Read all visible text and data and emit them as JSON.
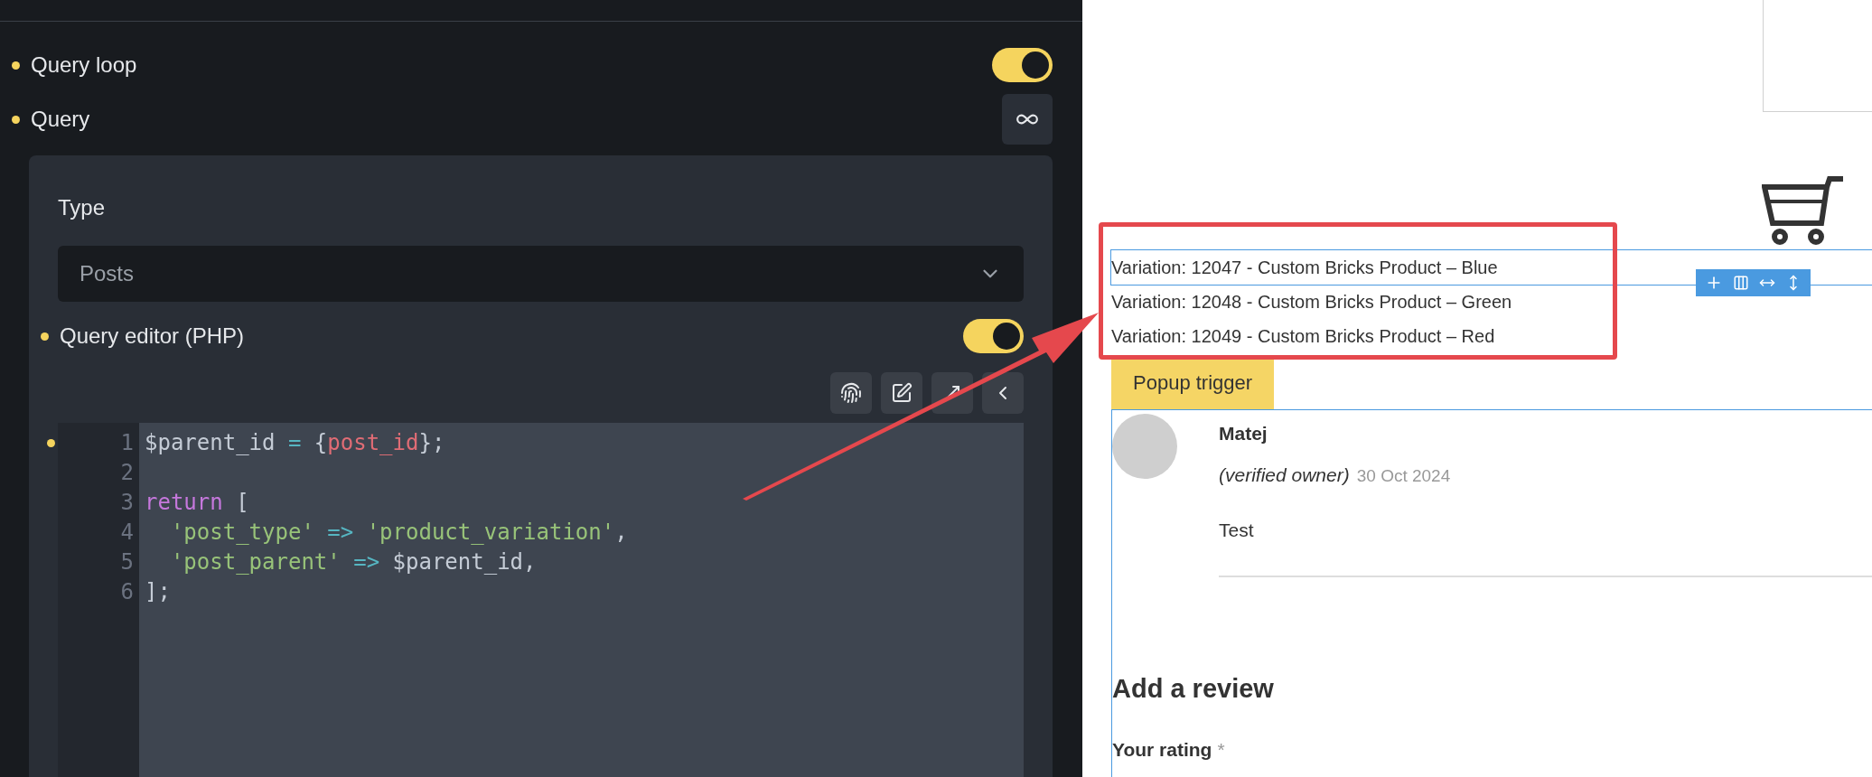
{
  "panel": {
    "query_loop": {
      "label": "Query loop",
      "on": true
    },
    "query": {
      "label": "Query"
    },
    "popover": {
      "type_label": "Type",
      "type_value": "Posts",
      "editor_toggle": {
        "label": "Query editor (PHP)",
        "on": true
      },
      "code_lines": [
        {
          "number": "1",
          "tokens": [
            {
              "kind": "plain",
              "text": "$parent_id"
            },
            {
              "kind": "operator",
              "text": " = "
            },
            {
              "kind": "plain",
              "text": "{"
            },
            {
              "kind": "tag",
              "text": "post_id"
            },
            {
              "kind": "plain",
              "text": "};"
            }
          ]
        },
        {
          "number": "2"
        },
        {
          "number": "3",
          "tokens": [
            {
              "kind": "keyword",
              "text": "return"
            },
            {
              "kind": "plain",
              "text": " ["
            }
          ]
        },
        {
          "number": "4",
          "tokens": [
            {
              "kind": "string",
              "text": "  'post_type'"
            },
            {
              "kind": "operator",
              "text": " => "
            },
            {
              "kind": "string",
              "text": "'product_variation'"
            },
            {
              "kind": "plain",
              "text": ","
            }
          ]
        },
        {
          "number": "5",
          "tokens": [
            {
              "kind": "string",
              "text": "  'post_parent'"
            },
            {
              "kind": "operator",
              "text": " => "
            },
            {
              "kind": "plain",
              "text": "$parent_id,"
            }
          ]
        },
        {
          "number": "6",
          "tokens": [
            {
              "kind": "plain",
              "text": "];"
            }
          ]
        }
      ]
    }
  },
  "preview": {
    "variations": [
      "Variation: 12047 - Custom Bricks Product – Blue",
      "Variation: 12048 - Custom Bricks Product – Green",
      "Variation: 12049 - Custom Bricks Product – Red"
    ],
    "popup_button": "Popup trigger",
    "review": {
      "author": "Matej",
      "verified": "(verified owner)",
      "date": "30 Oct 2024",
      "text": "Test"
    },
    "add_review_heading": "Add a review",
    "rating_label": "Your rating",
    "required_mark": "*"
  }
}
